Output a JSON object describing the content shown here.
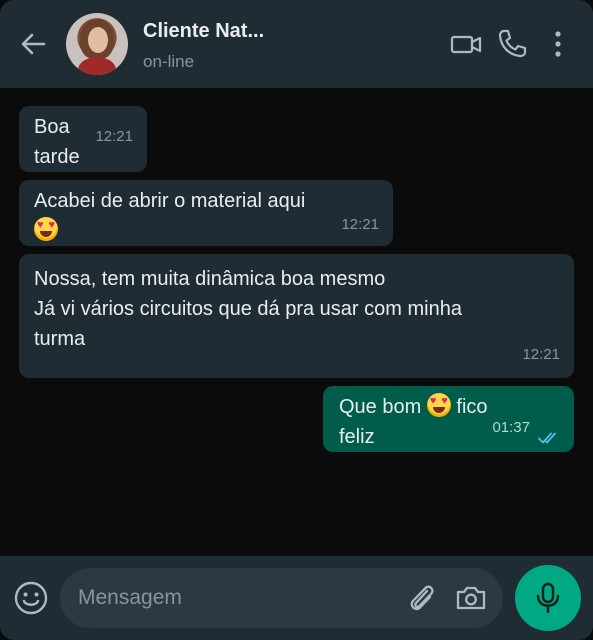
{
  "header": {
    "contact_name": "Cliente Nat...",
    "status": "on-line"
  },
  "messages": [
    {
      "direction": "incoming",
      "text_line1": "Boa",
      "text_line2": "tarde",
      "time": "12:21"
    },
    {
      "direction": "incoming",
      "text_line1": "Acabei de abrir o material aqui",
      "emoji": "smiling-face-with-heart-eyes",
      "time": "12:21"
    },
    {
      "direction": "incoming",
      "text_line1": "Nossa, tem muita dinâmica boa mesmo",
      "text_line2": "Já vi vários circuitos que dá pra usar com minha",
      "text_line3": "turma",
      "time": "12:21"
    },
    {
      "direction": "outgoing",
      "text_before": "Que bom",
      "emoji": "smiling-face-with-heart-eyes",
      "text_after": "fico",
      "text_line2": "feliz",
      "time": "01:37",
      "status": "read"
    }
  ],
  "footer": {
    "placeholder": "Mensagem"
  },
  "colors": {
    "header_bg": "#1f2c34",
    "chat_bg": "#0b0b0b",
    "incoming_bubble": "#202c33",
    "outgoing_bubble": "#005c4b",
    "accent": "#00a884",
    "read_ticks": "#53bdeb"
  },
  "icons": [
    "back-arrow-icon",
    "video-call-icon",
    "phone-icon",
    "more-vert-icon",
    "emoji-icon",
    "attach-icon",
    "camera-icon",
    "mic-icon"
  ]
}
